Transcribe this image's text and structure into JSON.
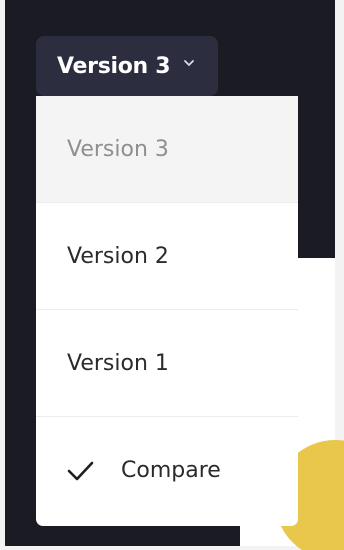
{
  "header": {
    "version_button_label": "Version 3",
    "chevron_icon": "chevron-down-icon"
  },
  "dropdown": {
    "items": [
      {
        "label": "Version 3",
        "selected": true
      },
      {
        "label": "Version 2",
        "selected": false
      },
      {
        "label": "Version 1",
        "selected": false
      },
      {
        "label": "Compare",
        "checked": true,
        "icon": "check-icon"
      }
    ]
  },
  "colors": {
    "dark_background": "#1b1b24",
    "button_background": "#2c2d3f",
    "menu_background": "#ffffff",
    "selected_item_background": "#f4f4f4",
    "selected_item_text": "#8f8f8f",
    "accent_yellow": "#e8c74b"
  }
}
